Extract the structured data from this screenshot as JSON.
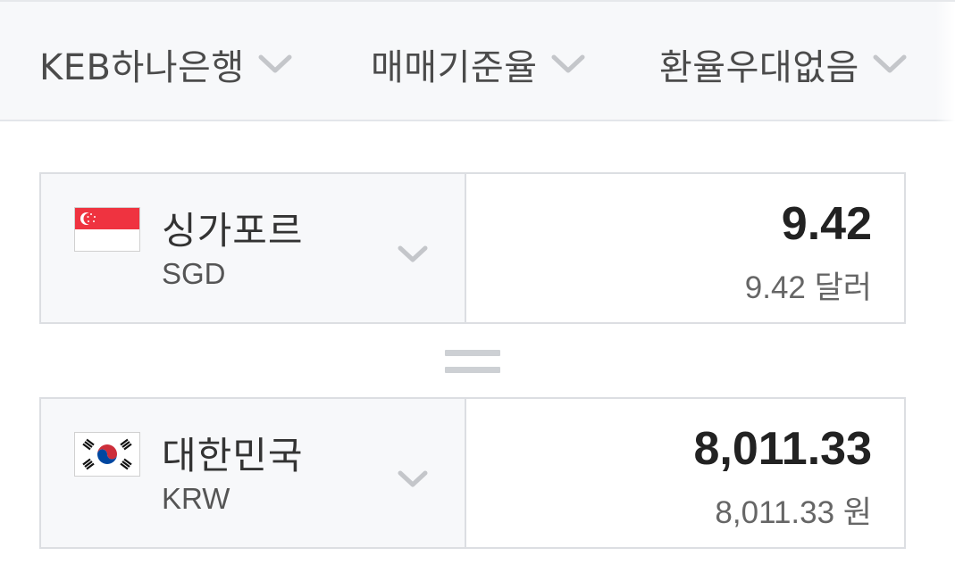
{
  "filters": [
    {
      "label": "KEB하나은행",
      "icon": "chevron-down-icon"
    },
    {
      "label": "매매기준율",
      "icon": "chevron-down-icon"
    },
    {
      "label": "환율우대없음",
      "icon": "chevron-down-icon"
    }
  ],
  "from": {
    "flag": "singapore-flag-icon",
    "name": "싱가포르",
    "code": "SGD",
    "amount": "9.42",
    "amount_text": "9.42 달러"
  },
  "to": {
    "flag": "south-korea-flag-icon",
    "name": "대한민국",
    "code": "KRW",
    "amount": "8,011.33",
    "amount_text": "8,011.33 원"
  },
  "equals_icon": "equals-icon",
  "colors": {
    "bar_background": "#f7f8fa",
    "border": "#dcdee2",
    "singapore_red": "#ef3340",
    "korea_red": "#cd2e3a",
    "korea_blue": "#0047a0"
  }
}
